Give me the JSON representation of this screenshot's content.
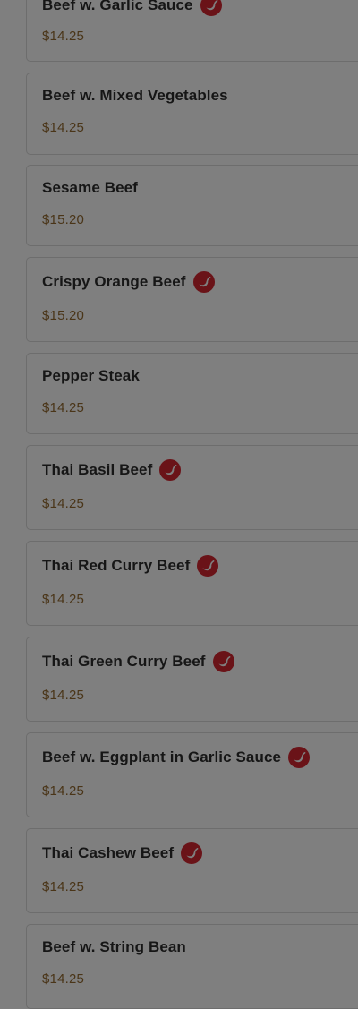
{
  "menu": {
    "spicy_icon_color": "#6a1318",
    "items": [
      {
        "name": "Beef w. Garlic Sauce",
        "price": "$14.25",
        "spicy": true
      },
      {
        "name": "Beef w. Mixed Vegetables",
        "price": "$14.25",
        "spicy": false
      },
      {
        "name": "Sesame Beef",
        "price": "$15.20",
        "spicy": false
      },
      {
        "name": "Crispy Orange Beef",
        "price": "$15.20",
        "spicy": true
      },
      {
        "name": "Pepper Steak",
        "price": "$14.25",
        "spicy": false
      },
      {
        "name": "Thai Basil Beef",
        "price": "$14.25",
        "spicy": true
      },
      {
        "name": "Thai Red Curry Beef",
        "price": "$14.25",
        "spicy": true
      },
      {
        "name": "Thai Green Curry Beef",
        "price": "$14.25",
        "spicy": true
      },
      {
        "name": "Beef w. Eggplant in Garlic Sauce",
        "price": "$14.25",
        "spicy": true
      },
      {
        "name": "Thai Cashew Beef",
        "price": "$14.25",
        "spicy": true
      },
      {
        "name": "Beef w. String Bean",
        "price": "$14.25",
        "spicy": false
      }
    ]
  }
}
